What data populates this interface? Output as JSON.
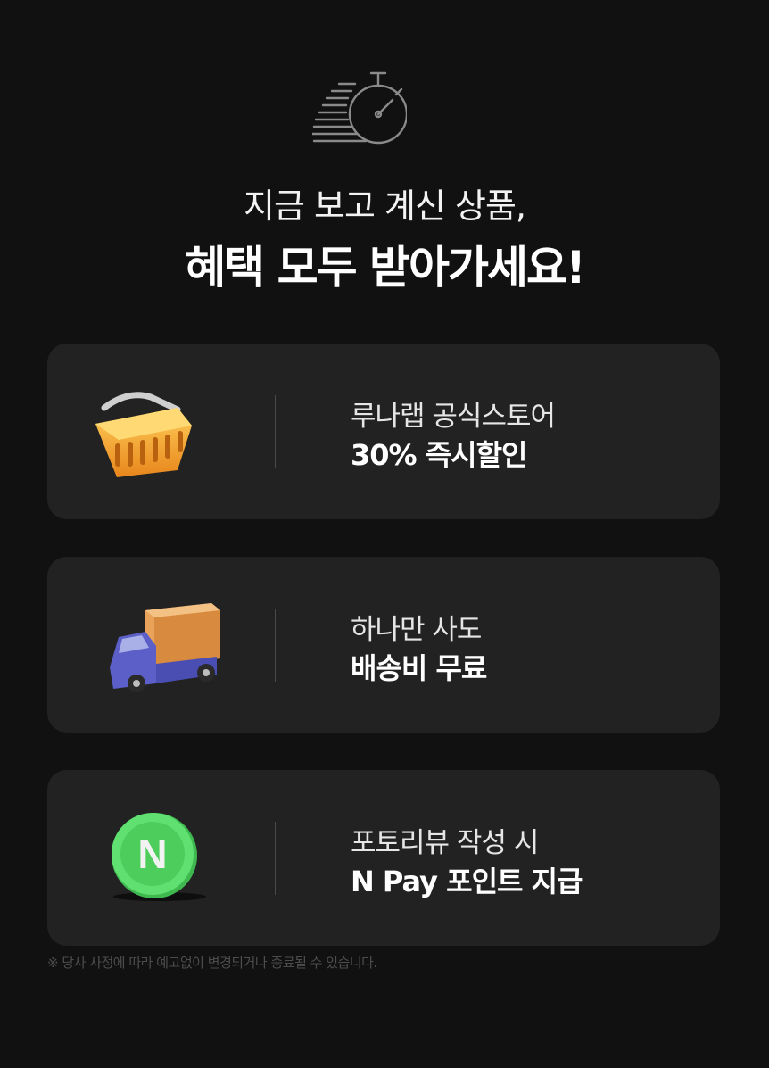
{
  "header": {
    "line1": "지금 보고 계신 상품,",
    "line2": "혜택 모두 받아가세요!"
  },
  "benefits": [
    {
      "icon": "basket-icon",
      "title": "루나랩 공식스토어",
      "highlight": "30% 즉시할인"
    },
    {
      "icon": "delivery-truck-icon",
      "title": "하나만 사도",
      "highlight": "배송비 무료"
    },
    {
      "icon": "npay-coin-icon",
      "title": "포토리뷰 작성 시",
      "highlight": "N Pay 포인트 지급",
      "coin_letter": "N"
    }
  ],
  "footnote": "※ 당사 사정에 따라 예고없이 변경되거나 종료될 수 있습니다.",
  "colors": {
    "background": "#111111",
    "card": "#222222",
    "basket": "#f5a623",
    "truck_body": "#5b5fc7",
    "truck_box": "#e8a25a",
    "coin": "#4cd964"
  }
}
